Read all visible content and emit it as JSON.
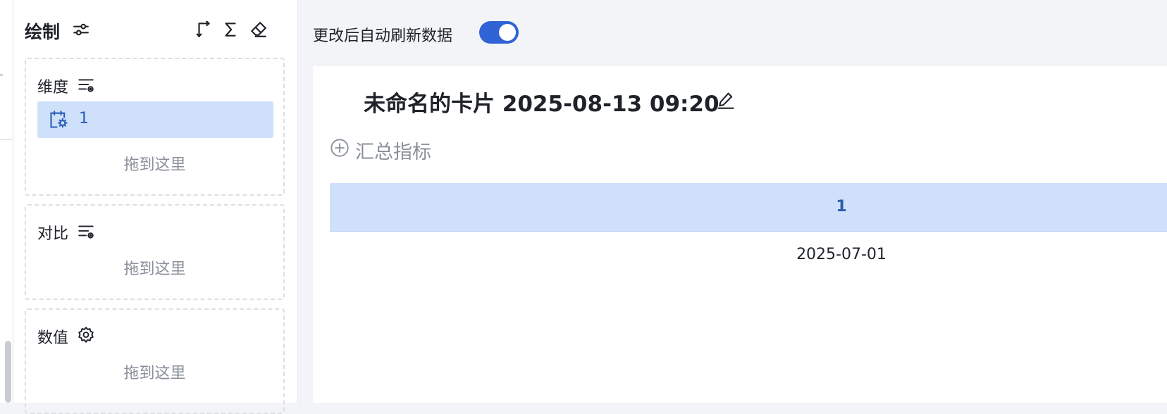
{
  "panel": {
    "title": "绘制",
    "zones": [
      {
        "label": "维度",
        "items": [
          {
            "label": "1"
          }
        ],
        "drop_text": "拖到这里"
      },
      {
        "label": "对比",
        "items": [],
        "drop_text": "拖到这里"
      },
      {
        "label": "数值",
        "items": [],
        "drop_text": "拖到这里"
      }
    ]
  },
  "topbar": {
    "auto_refresh_label": "更改后自动刷新数据",
    "auto_refresh_on": true
  },
  "card": {
    "title": "未命名的卡片 2025-08-13 09:20",
    "add_metric_label": "汇总指标",
    "table": {
      "columns": [
        "1"
      ],
      "rows": [
        [
          "2025-07-01"
        ]
      ]
    }
  },
  "colors": {
    "accent": "#2f63d6",
    "selected_bg": "#cfe0fb",
    "header_text": "#2f5aa8"
  }
}
